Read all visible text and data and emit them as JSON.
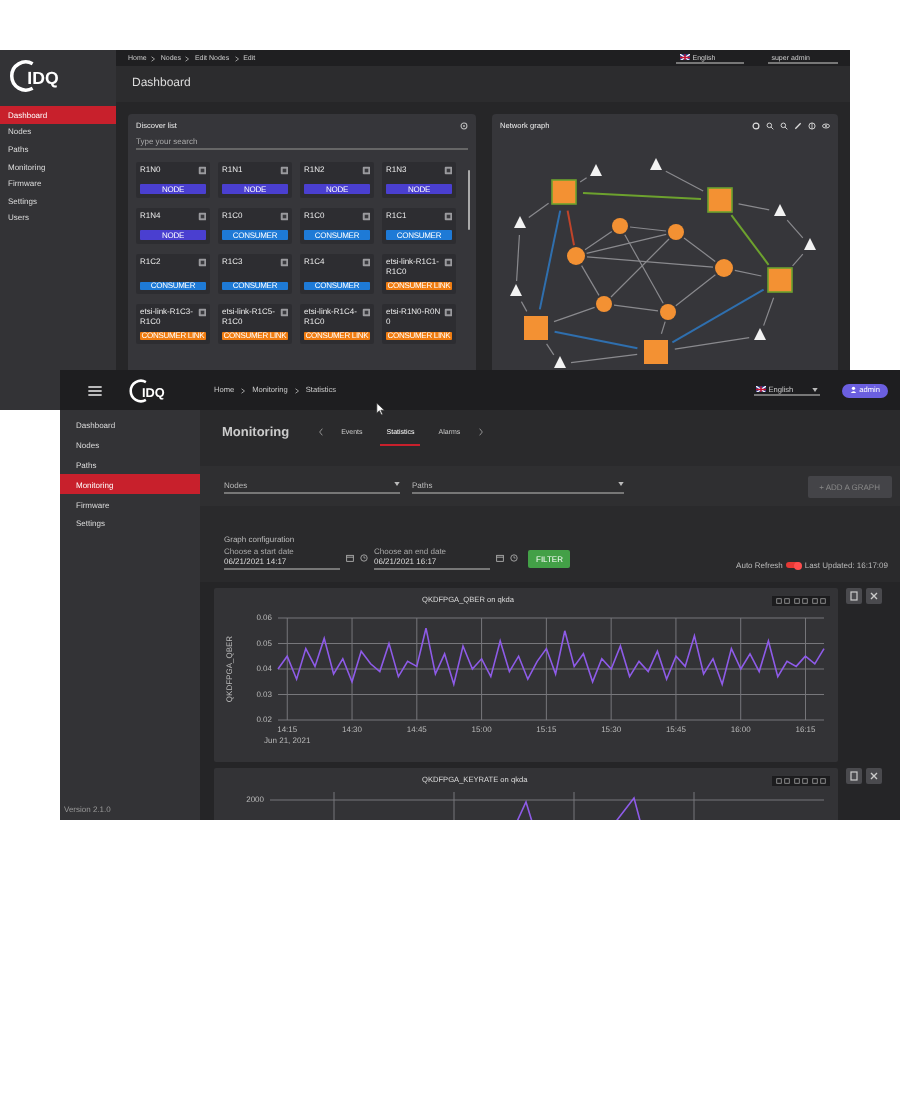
{
  "dashboard_window": {
    "logo": "IDQ",
    "breadcrumb": [
      "Home",
      "Nodes",
      "Edit Nodes",
      "Edit"
    ],
    "language": "English",
    "user": "super admin",
    "title": "Dashboard",
    "sidebar": [
      {
        "label": "Dashboard",
        "selected": true
      },
      {
        "label": "Nodes",
        "selected": false
      },
      {
        "label": "Paths",
        "selected": false
      },
      {
        "label": "Monitoring",
        "selected": false
      },
      {
        "label": "Firmware",
        "selected": false
      },
      {
        "label": "Settings",
        "selected": false
      },
      {
        "label": "Users",
        "selected": false
      }
    ],
    "discover_list": {
      "title": "Discover list",
      "search": {
        "placeholder": "Type your search"
      },
      "cards": [
        {
          "name": "R1N0",
          "kind": "node",
          "badge": "NODE"
        },
        {
          "name": "R1N1",
          "kind": "node",
          "badge": "NODE"
        },
        {
          "name": "R1N2",
          "kind": "node",
          "badge": "NODE"
        },
        {
          "name": "R1N3",
          "kind": "node",
          "badge": "NODE"
        },
        {
          "name": "R1N4",
          "kind": "node",
          "badge": "NODE"
        },
        {
          "name": "R1C0",
          "kind": "consumer",
          "badge": "CONSUMER"
        },
        {
          "name": "R1C0",
          "kind": "consumer",
          "badge": "CONSUMER"
        },
        {
          "name": "R1C1",
          "kind": "consumer",
          "badge": "CONSUMER"
        },
        {
          "name": "R1C2",
          "kind": "consumer",
          "badge": "CONSUMER"
        },
        {
          "name": "R1C3",
          "kind": "consumer",
          "badge": "CONSUMER"
        },
        {
          "name": "R1C4",
          "kind": "consumer",
          "badge": "CONSUMER"
        },
        {
          "name": "etsi-link-R1C1-R1C0",
          "kind": "link",
          "badge": "CONSUMER LINK"
        },
        {
          "name": "etsi-link-R1C3-R1C0",
          "kind": "link",
          "badge": "CONSUMER LINK"
        },
        {
          "name": "etsi-link-R1C5-R1C0",
          "kind": "link",
          "badge": "CONSUMER LINK"
        },
        {
          "name": "etsi-link-R1C4-R1C0",
          "kind": "link",
          "badge": "CONSUMER LINK"
        },
        {
          "name": "etsi-R1N0-R0N0",
          "kind": "link",
          "badge": "CONSUMER LINK"
        }
      ]
    },
    "network_graph": {
      "title": "Network graph"
    }
  },
  "monitoring_window": {
    "logo": "IDQ",
    "breadcrumb": [
      "Home",
      "Monitoring",
      "Statistics"
    ],
    "language": "English",
    "user": "admin",
    "sidebar": [
      {
        "label": "Dashboard",
        "selected": false
      },
      {
        "label": "Nodes",
        "selected": false
      },
      {
        "label": "Paths",
        "selected": false
      },
      {
        "label": "Monitoring",
        "selected": true
      },
      {
        "label": "Firmware",
        "selected": false
      },
      {
        "label": "Settings",
        "selected": false
      }
    ],
    "version": "Version 2.1.0",
    "title": "Monitoring",
    "tabs": [
      {
        "label": "Events",
        "selected": false
      },
      {
        "label": "Statistics",
        "selected": true
      },
      {
        "label": "Alarms",
        "selected": false
      }
    ],
    "filters": {
      "nodes": {
        "label": "Nodes"
      },
      "paths": {
        "label": "Paths"
      },
      "add_button": {
        "label": "+ ADD A GRAPH",
        "disabled": true
      }
    },
    "graph_config": {
      "title": "Graph configuration",
      "start": {
        "label": "Choose a start date",
        "value": "06/21/2021 14:17"
      },
      "end": {
        "label": "Choose an end date",
        "value": "06/21/2021 16:17"
      },
      "filter_button": "FILTER",
      "auto_refresh": {
        "label": "Auto Refresh",
        "on": true
      },
      "last_updated": "Last Updated: 16:17:09"
    },
    "charts": [
      {
        "title": "QKDFPGA_QBER on qkda",
        "x_date": "Jun 21, 2021",
        "chart_data": {
          "type": "line",
          "grid": true,
          "ylabel": "QKDFPGA_QBER",
          "ylim": [
            0.02,
            0.06
          ],
          "yticks": [
            0.02,
            0.03,
            0.04,
            0.05,
            0.06
          ],
          "categories": [
            null,
            "14:15",
            null,
            null,
            null,
            null,
            null,
            null,
            "14:30",
            null,
            null,
            null,
            null,
            null,
            null,
            "14:45",
            null,
            null,
            null,
            null,
            null,
            null,
            "15:00",
            null,
            null,
            null,
            null,
            null,
            null,
            "15:15",
            null,
            null,
            null,
            null,
            null,
            null,
            "15:30",
            null,
            null,
            null,
            null,
            null,
            null,
            "15:45",
            null,
            null,
            null,
            null,
            null,
            null,
            "16:00",
            null,
            null,
            null,
            null,
            null,
            null,
            "16:15",
            null,
            null
          ],
          "series": [
            {
              "color": "#8e5be8",
              "values": [
                0.04,
                0.045,
                0.036,
                0.048,
                0.041,
                0.052,
                0.038,
                0.044,
                0.035,
                0.047,
                0.042,
                0.039,
                0.05,
                0.037,
                0.043,
                0.041,
                0.056,
                0.038,
                0.046,
                0.034,
                0.049,
                0.04,
                0.044,
                0.037,
                0.051,
                0.039,
                0.045,
                0.036,
                0.043,
                0.048,
                0.038,
                0.055,
                0.041,
                0.046,
                0.035,
                0.044,
                0.04,
                0.049,
                0.037,
                0.043,
                0.039,
                0.047,
                0.036,
                0.045,
                0.041,
                0.053,
                0.038,
                0.044,
                0.034,
                0.048,
                0.04,
                0.046,
                0.039,
                0.051,
                0.037,
                0.043,
                0.041,
                0.045,
                0.042,
                0.048
              ]
            }
          ]
        }
      },
      {
        "title": "QKDFPGA_KEYRATE on qkda",
        "y_tick": "2000"
      }
    ]
  }
}
